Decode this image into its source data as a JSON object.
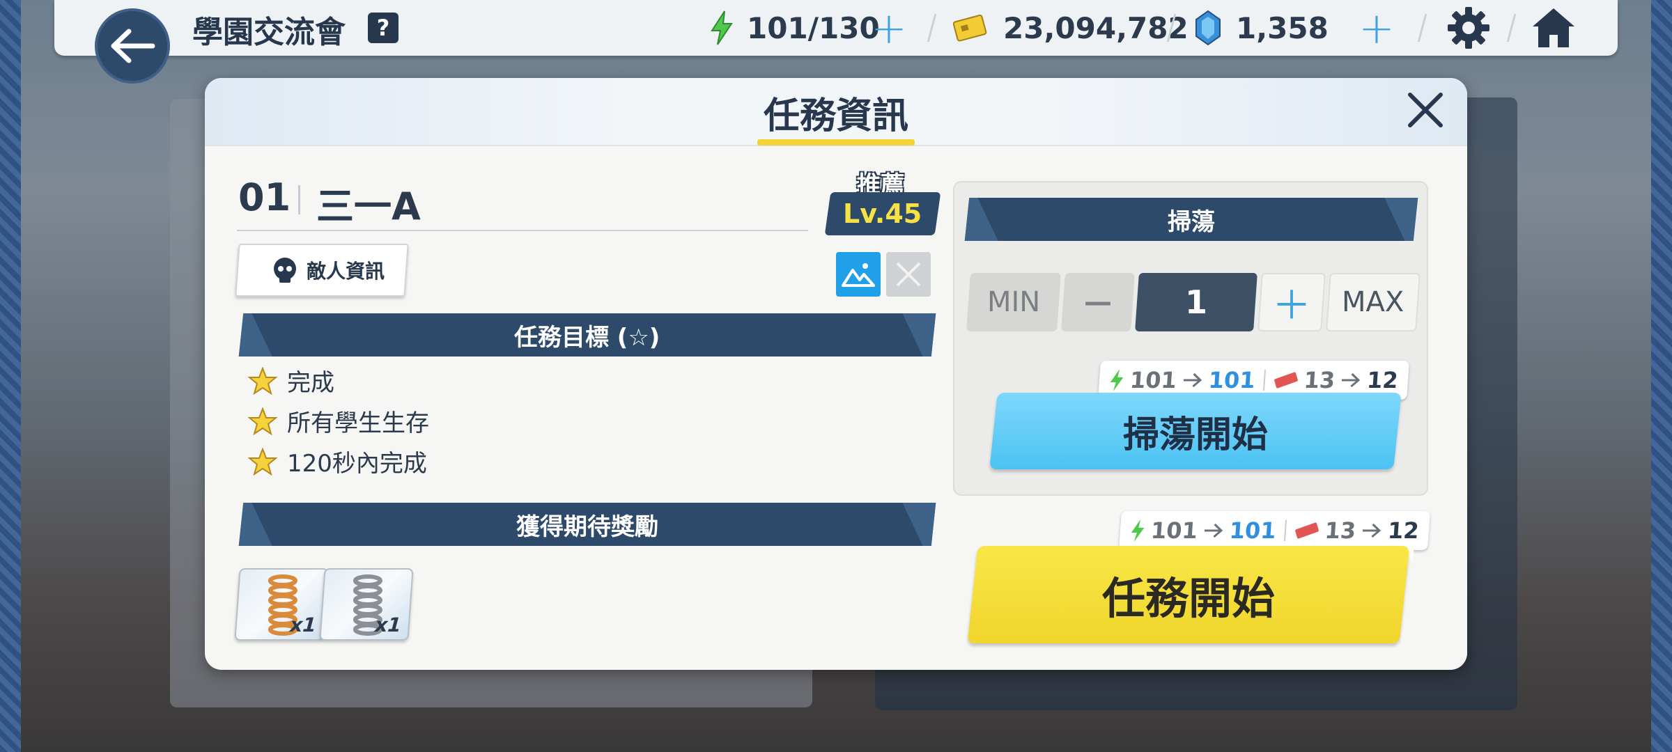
{
  "topbar": {
    "title": "學園交流會",
    "help": "?",
    "ap": "101/130",
    "credits": "23,094,782",
    "gems": "1,358"
  },
  "modal": {
    "title": "任務資訊",
    "stage_number": "01",
    "stage_name": "三一A",
    "recommended_label": "推薦",
    "recommended_level": "Lv.45",
    "enemy_info_label": "敵人資訊",
    "objectives_header": "任務目標 (☆)",
    "objectives": [
      "完成",
      "所有學生生存",
      "120秒內完成"
    ],
    "rewards_header": "獲得期待獎勵",
    "rewards": [
      {
        "qty": "x1",
        "color": "#d98a3a"
      },
      {
        "qty": "x1",
        "color": "#8c9096"
      }
    ]
  },
  "sweep": {
    "header": "掃蕩",
    "min_label": "MIN",
    "minus_label": "—",
    "count": "1",
    "plus_label": "＋",
    "max_label": "MAX",
    "start_label": "掃蕩開始",
    "cost": {
      "ap_from": "101",
      "ap_to": "101",
      "ticket_from": "13",
      "ticket_to": "12"
    }
  },
  "mission_start": {
    "label": "任務開始",
    "cost": {
      "ap_from": "101",
      "ap_to": "101",
      "ticket_from": "13",
      "ticket_to": "12"
    }
  },
  "colors": {
    "navy": "#2e4a6a",
    "yellow": "#f3d437",
    "cyan": "#4cc2f3",
    "accent_blue": "#2f8fe0"
  },
  "icons": [
    "back-arrow-icon",
    "help-icon",
    "ap-bolt-icon",
    "credit-card-icon",
    "gem-icon",
    "gear-icon",
    "home-icon",
    "close-icon",
    "skull-icon",
    "landscape-icon",
    "star-icon",
    "spring-icon",
    "ticket-icon",
    "arrow-right-icon"
  ]
}
